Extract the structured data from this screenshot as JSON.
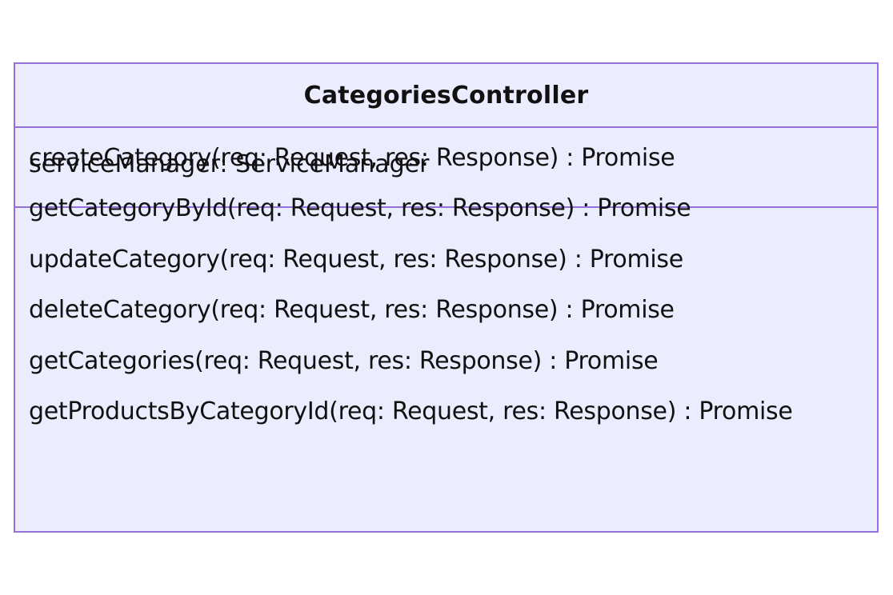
{
  "diagram": {
    "type": "uml-class",
    "class_name": "CategoriesController",
    "attributes": [
      "serviceManager: ServiceManager"
    ],
    "methods": [
      "createCategory(req: Request, res: Response) : Promise",
      "getCategoryById(req: Request, res: Response) : Promise",
      "updateCategory(req: Request, res: Response) : Promise",
      "deleteCategory(req: Request, res: Response) : Promise",
      "getCategories(req: Request, res: Response) : Promise",
      "getProductsByCategoryId(req: Request, res: Response) : Promise"
    ],
    "colors": {
      "fill": "#ececff",
      "border": "#9370db",
      "text": "#111111"
    }
  }
}
